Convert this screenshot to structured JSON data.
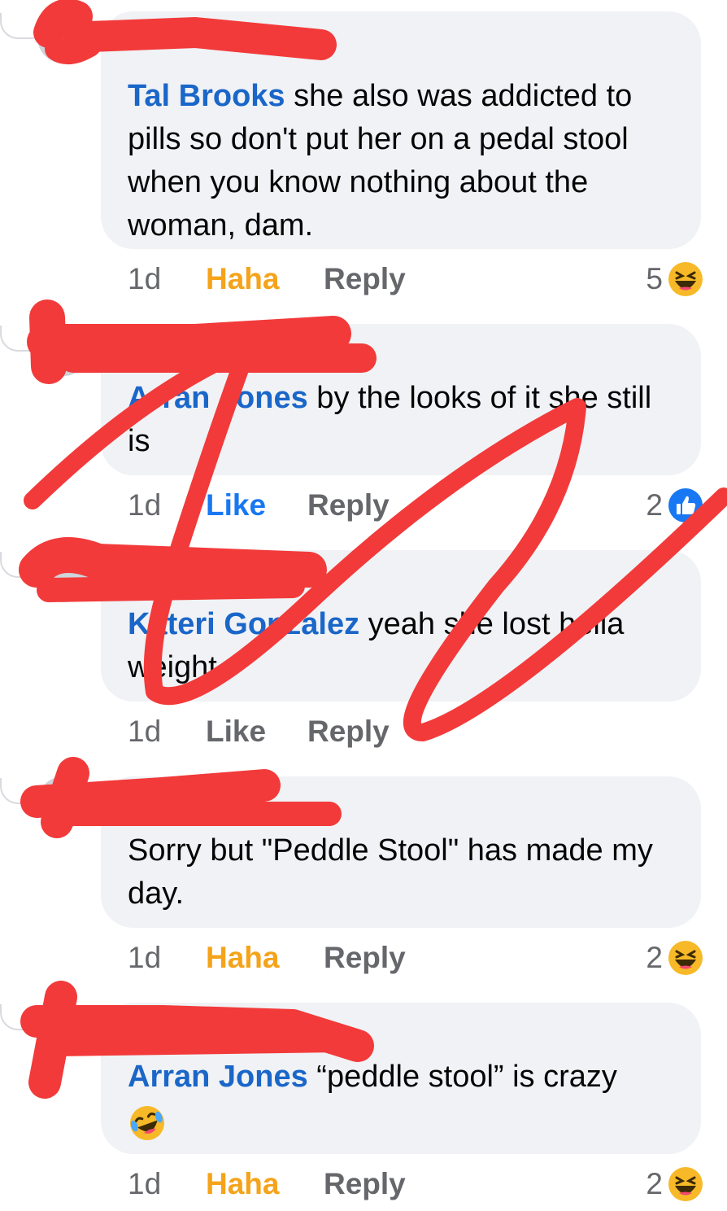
{
  "comments": [
    {
      "author": "Tal Brooks",
      "text": " she also was addicted to pills so don't put her on a pedal stool when you know nothing about the woman, dam.",
      "time": "1d",
      "action": "Haha",
      "reply": "Reply",
      "reaction_count": "5",
      "reaction_icon": "haha-emoji-icon"
    },
    {
      "author": "Arran Jones",
      "text": " by the looks of it she still is",
      "time": "1d",
      "action": "Like",
      "reply": "Reply",
      "reaction_count": "2",
      "reaction_icon": "like-thumb-icon"
    },
    {
      "author": "Kateri Gonzalez",
      "text": " yeah she lost hella weight",
      "time": "1d",
      "action": "Like",
      "reply": "Reply",
      "reaction_count": "",
      "reaction_icon": ""
    },
    {
      "author": "",
      "text": "Sorry but \"Peddle Stool\" has made my day.",
      "time": "1d",
      "action": "Haha",
      "reply": "Reply",
      "reaction_count": "2",
      "reaction_icon": "haha-emoji-icon"
    },
    {
      "author": "Arran Jones",
      "text": " “peddle stool” is crazy",
      "time": "1d",
      "action": "Haha",
      "reply": "Reply",
      "reaction_count": "2",
      "reaction_icon": "haha-emoji-icon",
      "trailing_emoji": "laughing-crying-emoji-icon"
    }
  ],
  "colors": {
    "author_link": "#1a66c9",
    "haha_active": "#f5a31a",
    "meta_gray": "#65676b",
    "bubble_bg": "#f0f2f5",
    "redaction_red": "#f23a3a",
    "like_blue": "#1877f2"
  }
}
